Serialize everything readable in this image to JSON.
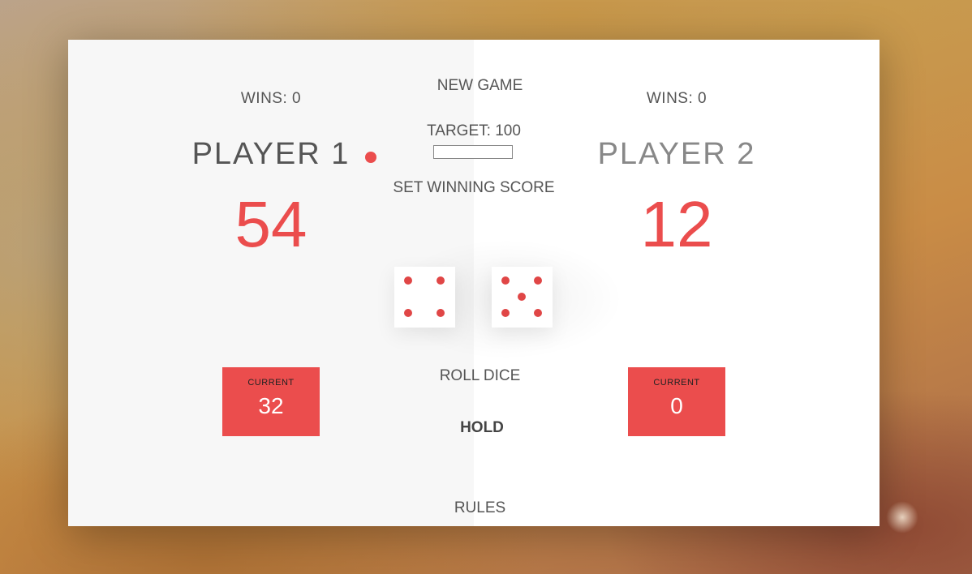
{
  "players": [
    {
      "wins_label": "WINS: 0",
      "name": "PLAYER 1",
      "score": "54",
      "current_label": "CURRENT",
      "current_value": "32",
      "active": true
    },
    {
      "wins_label": "WINS: 0",
      "name": "PLAYER 2",
      "score": "12",
      "current_label": "CURRENT",
      "current_value": "0",
      "active": false
    }
  ],
  "controls": {
    "new_game": "NEW GAME",
    "target_label": "TARGET: 100",
    "target_value": "",
    "set_score": "SET WINNING SCORE",
    "roll_dice": "ROLL DICE",
    "hold": "HOLD",
    "rules": "RULES"
  },
  "dice": [
    4,
    5
  ],
  "colors": {
    "accent": "#EB4D4D",
    "text": "#555555",
    "panel_active": "#F7F7F7",
    "panel_inactive": "#FFFFFF"
  }
}
